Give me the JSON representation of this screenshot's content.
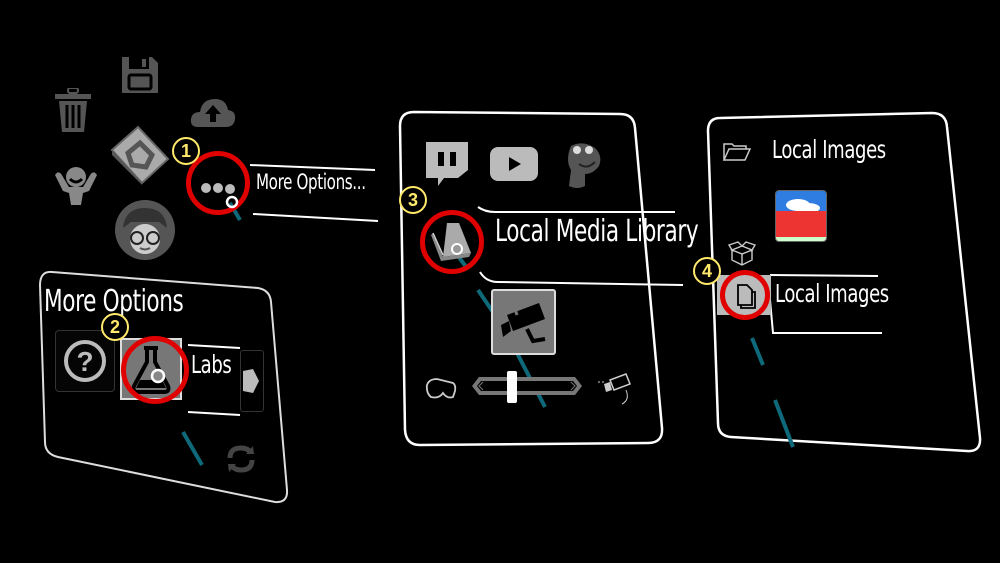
{
  "colors": {
    "highlight_ring": "#e00000",
    "step_badge": "#ffe96a",
    "pointer_ray": "#0e6a7a",
    "panel_border": "#ffffff"
  },
  "radial_menu": {
    "icons": [
      "save-icon",
      "trash-icon",
      "cloud-upload-icon",
      "app-logo-icon",
      "person-icon",
      "avatar",
      "more-options-icon"
    ],
    "tooltip": "More Options..."
  },
  "more_options_panel": {
    "title": "More Options",
    "items": [
      {
        "icon": "help-icon"
      },
      {
        "icon": "flask-icon",
        "label": "Labs"
      }
    ],
    "footer_icon": "refresh-icon"
  },
  "media_panel": {
    "apps": [
      "twitch-icon",
      "youtube-icon",
      "dinosaur-icon"
    ],
    "selected_label": "Local Media Library",
    "camera_icon": "video-camera-icon",
    "slider_value": 0.35
  },
  "images_panel": {
    "header": "Local Images",
    "item_label": "Local Images"
  },
  "steps": [
    "1",
    "2",
    "3",
    "4"
  ]
}
